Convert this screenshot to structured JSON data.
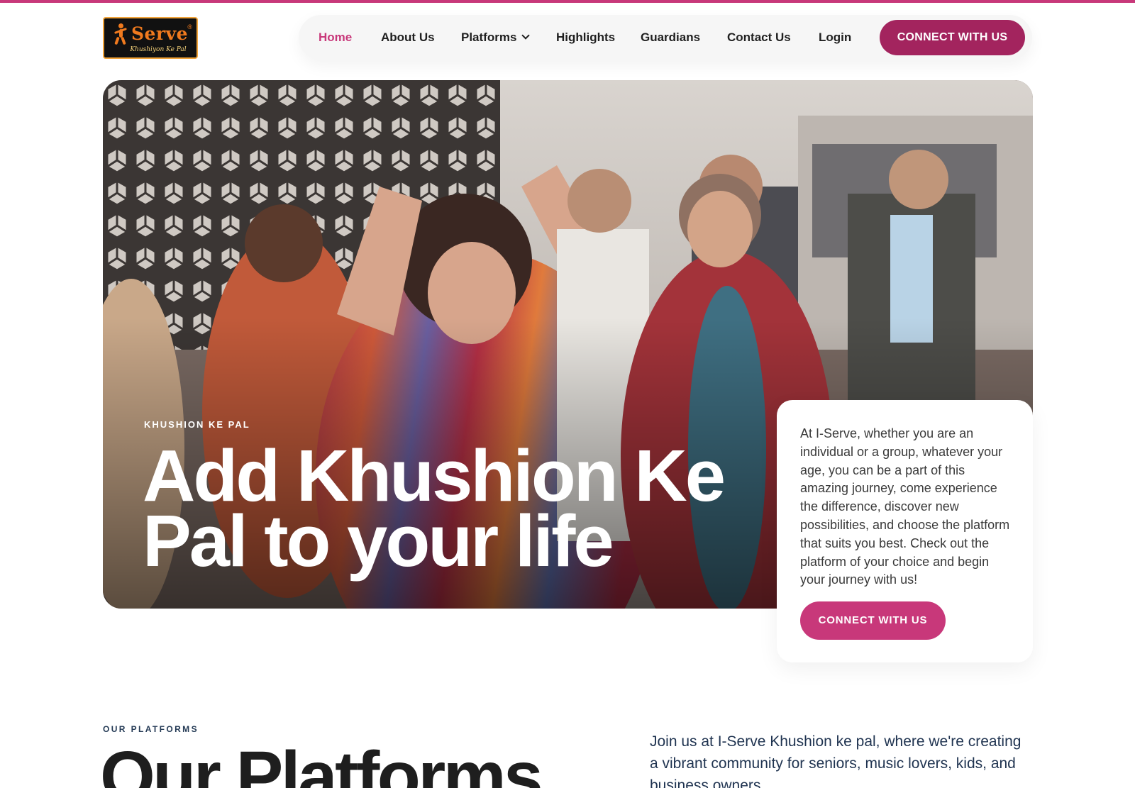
{
  "brand": {
    "logo_word": "Serve",
    "logo_reg": "®",
    "logo_tagline": "Khushiyon Ke Pal",
    "accent": "#c8387a",
    "cta_dark": "#a3245e"
  },
  "nav": {
    "items": [
      {
        "label": "Home",
        "active": true
      },
      {
        "label": "About Us"
      },
      {
        "label": "Platforms",
        "has_dropdown": true
      },
      {
        "label": "Highlights"
      },
      {
        "label": "Guardians"
      },
      {
        "label": "Contact Us"
      },
      {
        "label": "Login"
      }
    ],
    "cta_label": "CONNECT WITH US",
    "icons": {
      "dropdown": "chevron-down-icon"
    }
  },
  "hero": {
    "eyebrow": "KHUSHION KE PAL",
    "title": "Add Khushion Ke Pal to your life",
    "card_text": "At I-Serve, whether you are an individual or a group, whatever your age, you can be a part of this amazing journey, come experience the difference, discover new possibilities, and choose the platform that suits you best. Check out the platform of your choice and begin your journey with us!",
    "card_cta_label": "CONNECT WITH US"
  },
  "platforms": {
    "eyebrow": "OUR PLATFORMS",
    "title": "Our Platforms",
    "intro": "Join us at I-Serve Khushion ke pal, where we're creating a vibrant community for seniors, music lovers, kids, and business owners."
  }
}
